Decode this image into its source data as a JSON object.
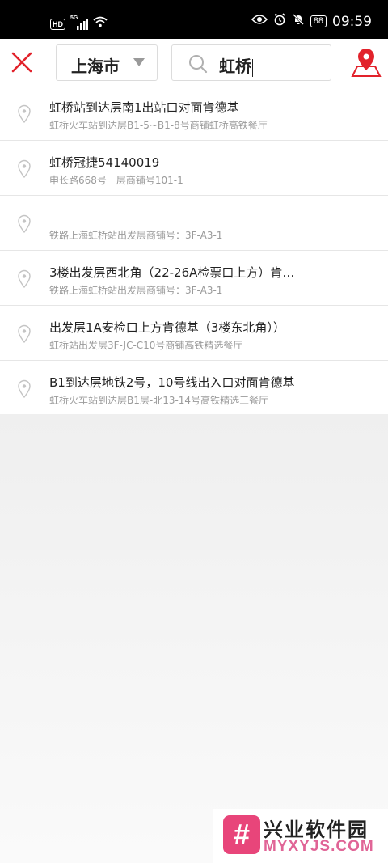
{
  "status_bar": {
    "network_badge": "HD",
    "signal_label": "5G",
    "battery_level": "88",
    "time": "09:59"
  },
  "toolbar": {
    "city": "上海市",
    "search_query": "虹桥",
    "accent_color": "#e2222b"
  },
  "results": [
    {
      "title": "虹桥站到达层南1出站口对面肯德基",
      "subtitle": "虹桥火车站到达层B1-5~B1-8号商铺虹桥高铁餐厅"
    },
    {
      "title": "虹桥冠捷54140019",
      "subtitle": "申长路668号一层商铺号101-1"
    },
    {
      "title": "",
      "subtitle": "铁路上海虹桥站出发层商铺号：3F-A3-1"
    },
    {
      "title": "3楼出发层西北角（22-26A检票口上方）肯…",
      "subtitle": "铁路上海虹桥站出发层商铺号：3F-A3-1"
    },
    {
      "title": "出发层1A安检口上方肯德基（3楼东北角））",
      "subtitle": "虹桥站出发层3F-JC-C10号商铺高铁精选餐厅"
    },
    {
      "title": "B1到达层地铁2号，10号线出入口对面肯德基",
      "subtitle": "虹桥火车站到达层B1层-北13-14号高铁精选三餐厅"
    }
  ],
  "watermark": {
    "logo_glyph": "#",
    "title": "兴业软件园",
    "subtitle": "MYXYJS.COM"
  }
}
